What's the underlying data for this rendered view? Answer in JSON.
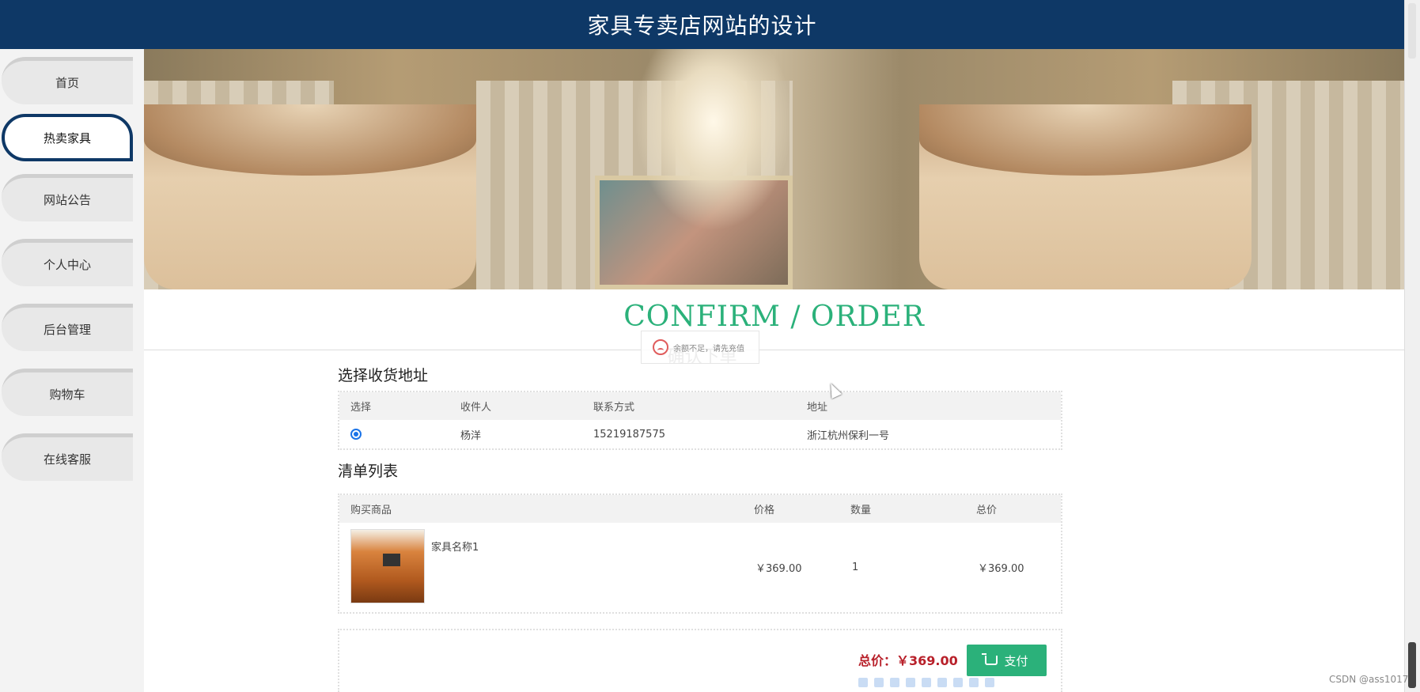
{
  "header": {
    "title": "家具专卖店网站的设计"
  },
  "sidebar": {
    "items": [
      {
        "label": "首页"
      },
      {
        "label": "热卖家具"
      },
      {
        "label": "网站公告"
      },
      {
        "label": "个人中心"
      },
      {
        "label": "后台管理"
      },
      {
        "label": "购物车"
      },
      {
        "label": "在线客服"
      }
    ],
    "active": "热卖家具"
  },
  "page": {
    "section_title": "CONFIRM / ORDER",
    "section_subtitle": "确认下单",
    "toast": {
      "text": "余额不足，请先充值",
      "icon": "sad-face-icon"
    }
  },
  "address": {
    "heading": "选择收货地址",
    "columns": [
      "选择",
      "收件人",
      "联系方式",
      "地址"
    ],
    "rows": [
      {
        "selected": true,
        "recipient": "杨洋",
        "phone": "15219187575",
        "address": "浙江杭州保利一号"
      }
    ]
  },
  "order_list": {
    "heading": "清单列表",
    "columns": [
      "购买商品",
      "价格",
      "数量",
      "总价"
    ],
    "rows": [
      {
        "name": "家具名称1",
        "price": "￥369.00",
        "quantity": "1",
        "total": "￥369.00"
      }
    ]
  },
  "summary": {
    "total_label": "总价：￥369.00",
    "pay_label": "支付",
    "pay_icon": "cart-icon",
    "accent_color": "#2bb17a",
    "price_color": "#b8202a"
  },
  "watermark": "CSDN @ass1017"
}
